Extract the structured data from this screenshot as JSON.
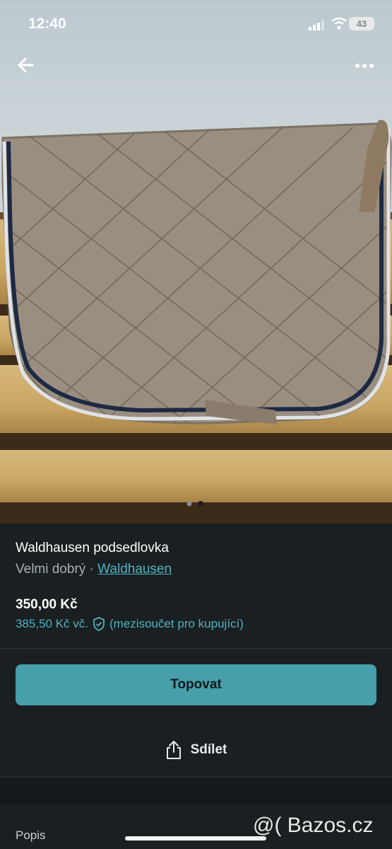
{
  "status_bar": {
    "time": "12:40",
    "battery": "43"
  },
  "listing": {
    "title": "Waldhausen podsedlovka",
    "condition": "Velmi dobrý",
    "separator": " · ",
    "brand": "Waldhausen",
    "price": "350,00 Kč",
    "buyer_price": "385,50 Kč vč.",
    "buyer_note": "(mezisoučet pro kupující)"
  },
  "actions": {
    "bump_label": "Topovat",
    "share_label": "Sdílet"
  },
  "description": {
    "heading": "Popis"
  },
  "carousel": {
    "count": 2,
    "active": 1
  },
  "watermark": "@( Bazos.cz",
  "colors": {
    "accent": "#4fb3bf",
    "button": "#469faa",
    "background": "#1a1f21"
  },
  "icons": [
    "back-arrow-icon",
    "more-dots-icon",
    "shield-check-icon",
    "share-icon"
  ]
}
